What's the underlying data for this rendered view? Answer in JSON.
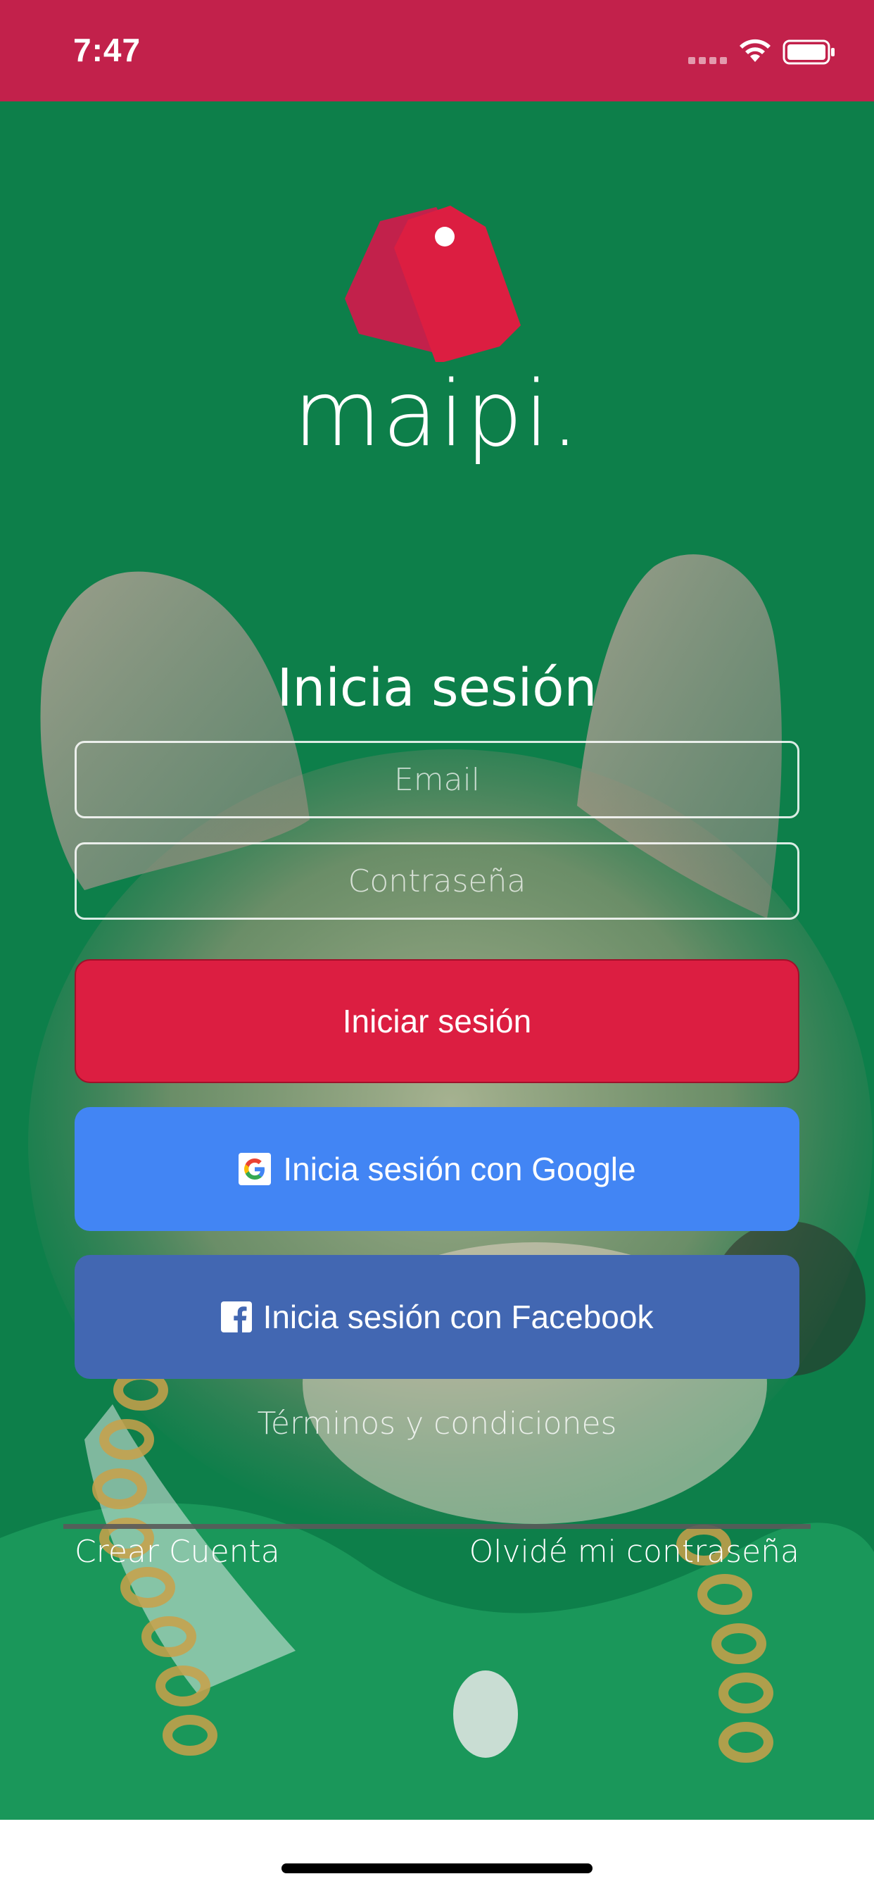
{
  "status_bar": {
    "time": "7:47",
    "icons": [
      "signal-dots-icon",
      "wifi-icon",
      "battery-icon"
    ],
    "color": "#c2214b"
  },
  "brand": {
    "name": "maipi.",
    "logo": "price-tag-icon",
    "logo_color": "#dc1e41"
  },
  "login": {
    "title": "Inicia sesión",
    "email_placeholder": "Email",
    "password_placeholder": "Contraseña",
    "submit_label": "Iniciar sesión",
    "google_label": "Inicia sesión con Google",
    "facebook_label": "Inicia sesión con Facebook",
    "submit_color": "#dc1e41",
    "google_color": "#4285f4",
    "facebook_color": "#4267b2"
  },
  "footer": {
    "terms_label": "Términos y condiciones",
    "create_account_label": "Crear Cuenta",
    "forgot_password_label": "Olvidé mi contraseña"
  },
  "background": {
    "color": "#0d7f4a",
    "image": "french-bulldog-photo"
  }
}
